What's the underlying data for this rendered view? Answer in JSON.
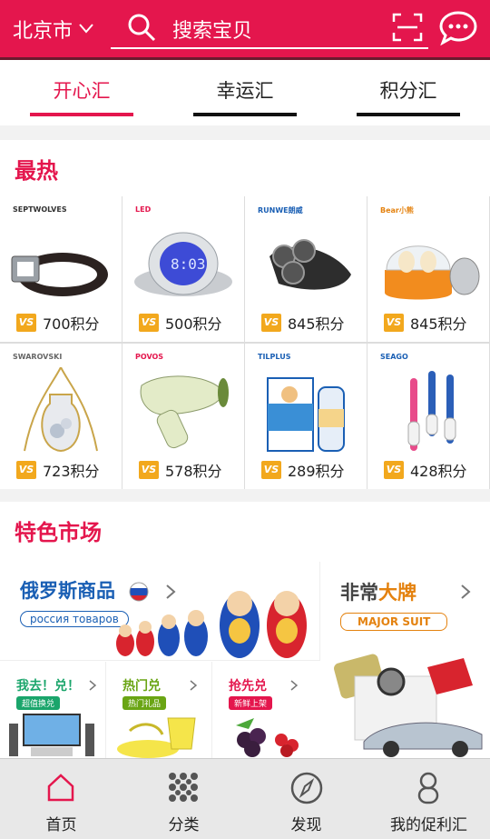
{
  "header": {
    "city": "北京市",
    "search_placeholder": "搜索宝贝",
    "icons": [
      "chevron-down-icon",
      "search-icon",
      "scan-icon",
      "message-icon"
    ],
    "accent": "#e4164d"
  },
  "tabs": [
    {
      "label": "开心汇",
      "active": true
    },
    {
      "label": "幸运汇",
      "active": false
    },
    {
      "label": "积分汇",
      "active": false
    }
  ],
  "hot": {
    "title": "最热",
    "items": [
      {
        "brand": "SEPTWOLVES",
        "price": "700积分",
        "badge": "VS"
      },
      {
        "brand": "LED",
        "price": "500积分",
        "badge": "VS"
      },
      {
        "brand": "RUNWE朗威",
        "price": "845积分",
        "badge": "VS"
      },
      {
        "brand": "Bear小熊",
        "price": "845积分",
        "badge": "VS"
      },
      {
        "brand": "SWAROVSKI",
        "price": "723积分",
        "badge": "VS"
      },
      {
        "brand": "POVOS",
        "price": "578积分",
        "badge": "VS"
      },
      {
        "brand": "TILPLUS",
        "price": "289积分",
        "badge": "VS"
      },
      {
        "brand": "SEAGO",
        "price": "428积分",
        "badge": "VS"
      }
    ]
  },
  "market": {
    "title": "特色市场",
    "russia": {
      "title": "俄罗斯商品",
      "pill": "россия товаров"
    },
    "brand": {
      "title_a": "非常",
      "title_b": "大牌",
      "pill": "MAJOR SUIT"
    },
    "subs": [
      {
        "title": "我去！兑！",
        "pill": "超值换兑",
        "color": "#1aa56b"
      },
      {
        "title": "热门兑",
        "pill": "热门礼品",
        "color": "#6aa514"
      },
      {
        "title": "抢先兑",
        "pill": "新鲜上架",
        "color": "#e4164d"
      }
    ]
  },
  "bottom_nav": [
    {
      "label": "首页",
      "icon": "home-icon"
    },
    {
      "label": "分类",
      "icon": "category-grid-icon"
    },
    {
      "label": "发现",
      "icon": "compass-icon"
    },
    {
      "label": "我的促利汇",
      "icon": "user-icon"
    }
  ]
}
